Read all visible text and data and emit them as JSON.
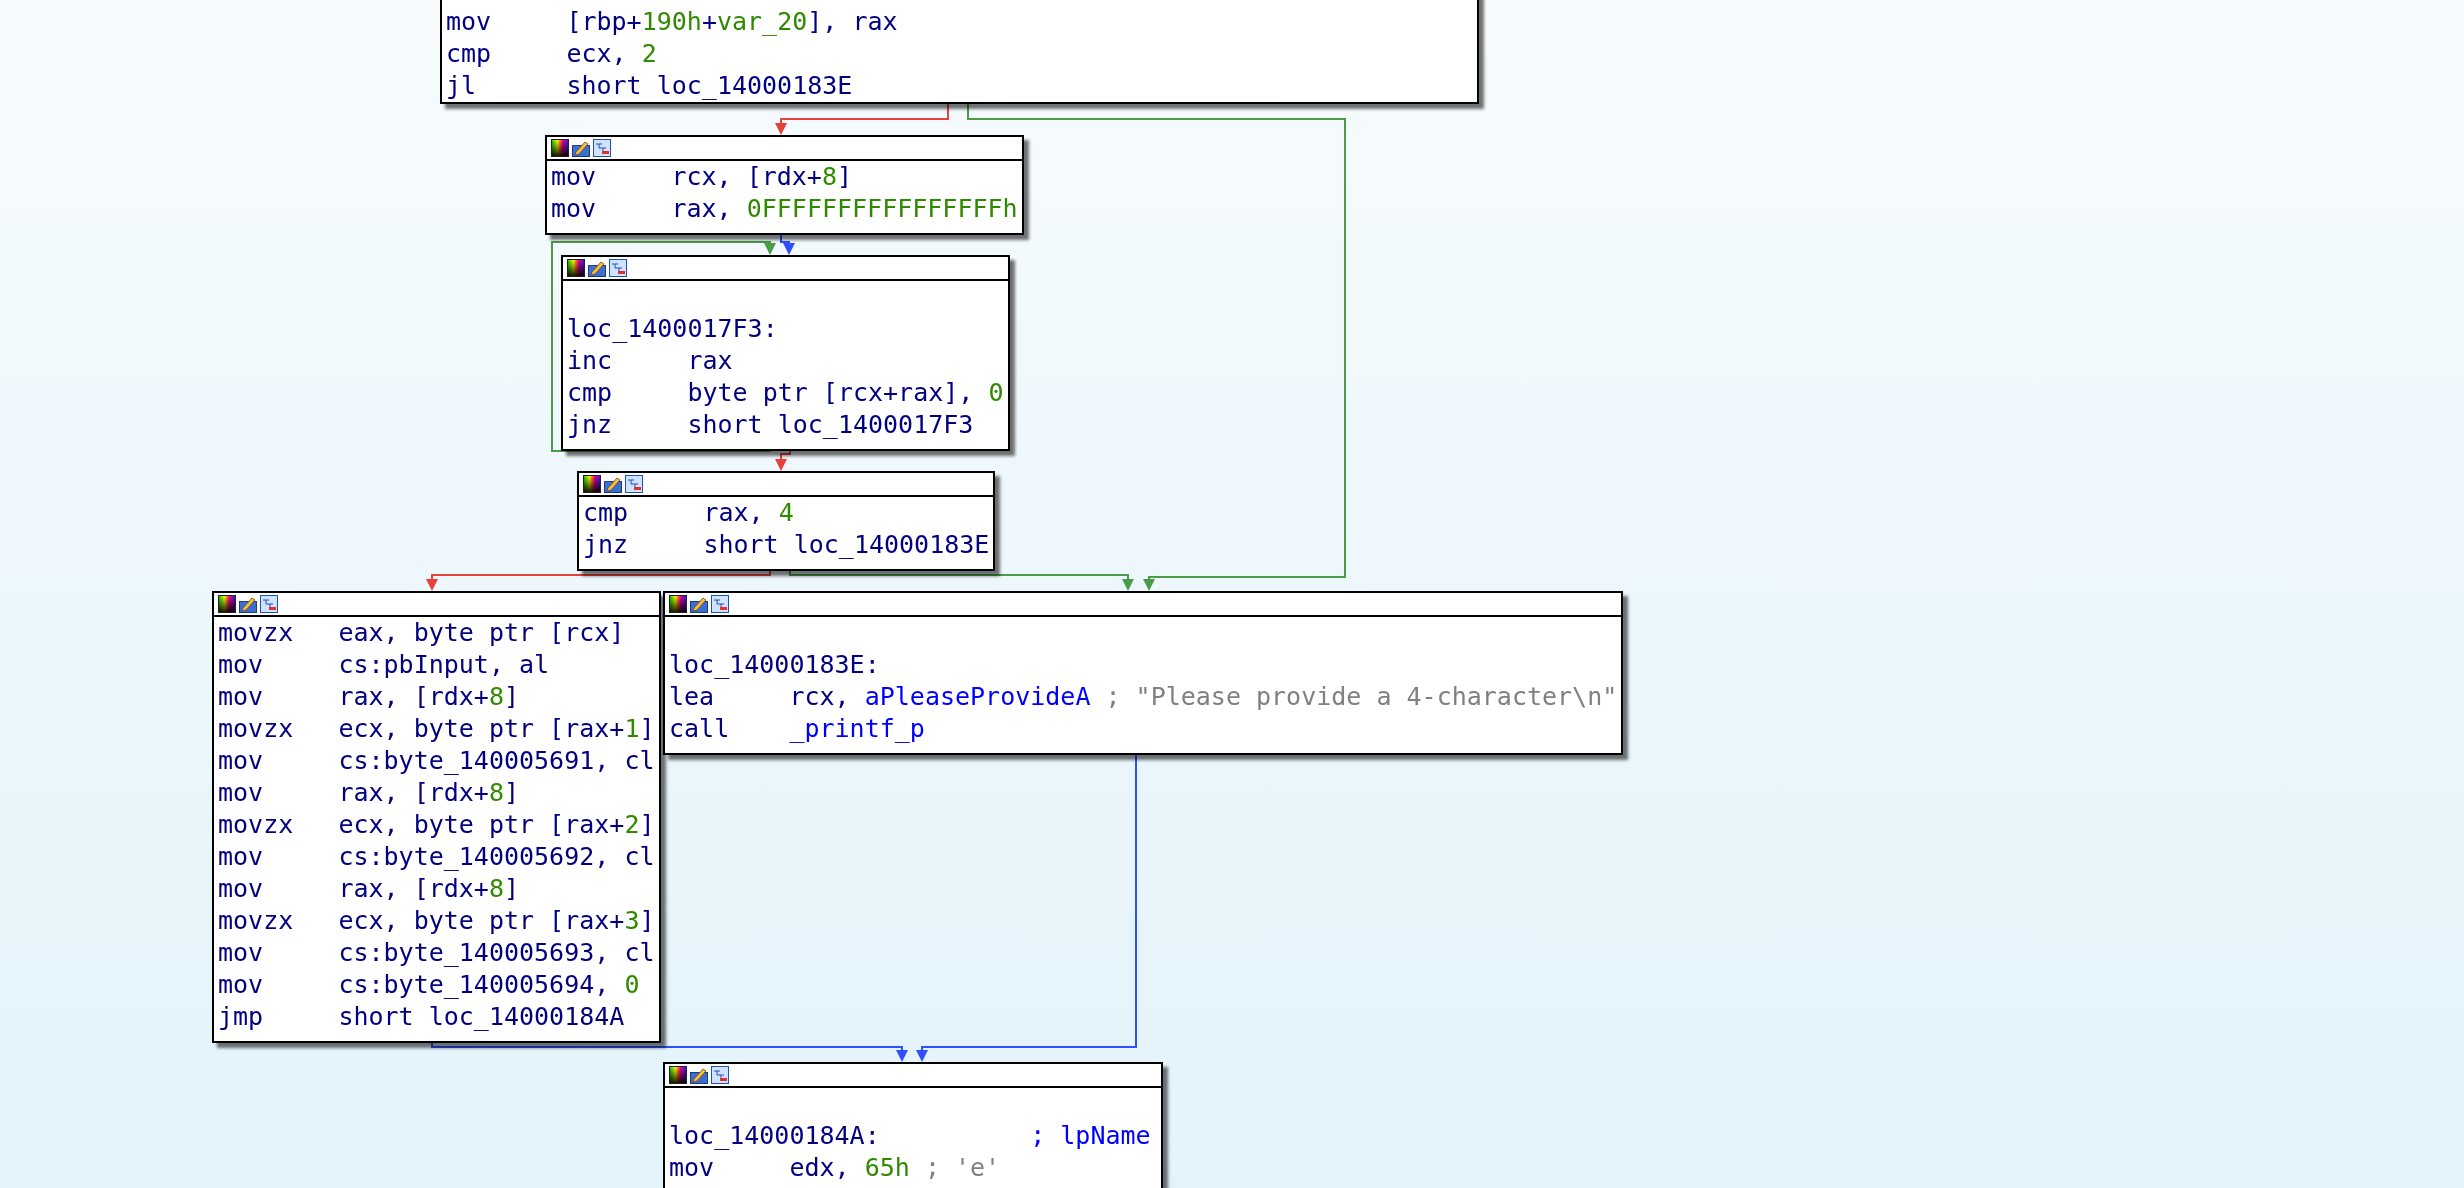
{
  "graph": {
    "nodes": [
      {
        "toolbar": false,
        "lines": [
          {
            "kind": "instruction",
            "mnemonic": "mov",
            "operands": [
              {
                "text": "[rbp+",
                "kind": "plain"
              },
              {
                "text": "190h",
                "kind": "number"
              },
              {
                "text": "+",
                "kind": "plain"
              },
              {
                "text": "var_20",
                "kind": "number"
              },
              {
                "text": "], rax",
                "kind": "plain"
              }
            ]
          },
          {
            "kind": "instruction",
            "mnemonic": "cmp",
            "operands": [
              {
                "text": "ecx, ",
                "kind": "plain"
              },
              {
                "text": "2",
                "kind": "number"
              }
            ]
          },
          {
            "kind": "instruction",
            "mnemonic": "jl",
            "operands": [
              {
                "text": "short loc_14000183E",
                "kind": "plain"
              }
            ]
          }
        ]
      },
      {
        "toolbar": true,
        "lines": [
          {
            "kind": "instruction",
            "mnemonic": "mov",
            "operands": [
              {
                "text": "rcx, [rdx+",
                "kind": "plain"
              },
              {
                "text": "8",
                "kind": "number"
              },
              {
                "text": "]",
                "kind": "plain"
              }
            ]
          },
          {
            "kind": "instruction",
            "mnemonic": "mov",
            "operands": [
              {
                "text": "rax, ",
                "kind": "plain"
              },
              {
                "text": "0FFFFFFFFFFFFFFFFh",
                "kind": "number"
              }
            ]
          }
        ]
      },
      {
        "toolbar": true,
        "lines": [
          {
            "kind": "blank"
          },
          {
            "kind": "label",
            "text": "loc_1400017F3:"
          },
          {
            "kind": "instruction",
            "mnemonic": "inc",
            "operands": [
              {
                "text": "rax",
                "kind": "plain"
              }
            ]
          },
          {
            "kind": "instruction",
            "mnemonic": "cmp",
            "operands": [
              {
                "text": "byte ptr [rcx+rax], ",
                "kind": "plain"
              },
              {
                "text": "0",
                "kind": "number"
              }
            ]
          },
          {
            "kind": "instruction",
            "mnemonic": "jnz",
            "operands": [
              {
                "text": "short loc_1400017F3",
                "kind": "plain"
              }
            ]
          }
        ]
      },
      {
        "toolbar": true,
        "lines": [
          {
            "kind": "instruction",
            "mnemonic": "cmp",
            "operands": [
              {
                "text": "rax, ",
                "kind": "plain"
              },
              {
                "text": "4",
                "kind": "number"
              }
            ]
          },
          {
            "kind": "instruction",
            "mnemonic": "jnz",
            "operands": [
              {
                "text": "short loc_14000183E",
                "kind": "plain"
              }
            ]
          }
        ]
      },
      {
        "toolbar": true,
        "lines": [
          {
            "kind": "instruction",
            "mnemonic": "movzx",
            "operands": [
              {
                "text": "eax, byte ptr [rcx]",
                "kind": "plain"
              }
            ]
          },
          {
            "kind": "instruction",
            "mnemonic": "mov",
            "operands": [
              {
                "text": "cs:pbInput, al",
                "kind": "plain"
              }
            ]
          },
          {
            "kind": "instruction",
            "mnemonic": "mov",
            "operands": [
              {
                "text": "rax, [rdx+",
                "kind": "plain"
              },
              {
                "text": "8",
                "kind": "number"
              },
              {
                "text": "]",
                "kind": "plain"
              }
            ]
          },
          {
            "kind": "instruction",
            "mnemonic": "movzx",
            "operands": [
              {
                "text": "ecx, byte ptr [rax+",
                "kind": "plain"
              },
              {
                "text": "1",
                "kind": "number"
              },
              {
                "text": "]",
                "kind": "plain"
              }
            ]
          },
          {
            "kind": "instruction",
            "mnemonic": "mov",
            "operands": [
              {
                "text": "cs:byte_140005691, cl",
                "kind": "plain"
              }
            ]
          },
          {
            "kind": "instruction",
            "mnemonic": "mov",
            "operands": [
              {
                "text": "rax, [rdx+",
                "kind": "plain"
              },
              {
                "text": "8",
                "kind": "number"
              },
              {
                "text": "]",
                "kind": "plain"
              }
            ]
          },
          {
            "kind": "instruction",
            "mnemonic": "movzx",
            "operands": [
              {
                "text": "ecx, byte ptr [rax+",
                "kind": "plain"
              },
              {
                "text": "2",
                "kind": "number"
              },
              {
                "text": "]",
                "kind": "plain"
              }
            ]
          },
          {
            "kind": "instruction",
            "mnemonic": "mov",
            "operands": [
              {
                "text": "cs:byte_140005692, cl",
                "kind": "plain"
              }
            ]
          },
          {
            "kind": "instruction",
            "mnemonic": "mov",
            "operands": [
              {
                "text": "rax, [rdx+",
                "kind": "plain"
              },
              {
                "text": "8",
                "kind": "number"
              },
              {
                "text": "]",
                "kind": "plain"
              }
            ]
          },
          {
            "kind": "instruction",
            "mnemonic": "movzx",
            "operands": [
              {
                "text": "ecx, byte ptr [rax+",
                "kind": "plain"
              },
              {
                "text": "3",
                "kind": "number"
              },
              {
                "text": "]",
                "kind": "plain"
              }
            ]
          },
          {
            "kind": "instruction",
            "mnemonic": "mov",
            "operands": [
              {
                "text": "cs:byte_140005693, cl",
                "kind": "plain"
              }
            ]
          },
          {
            "kind": "instruction",
            "mnemonic": "mov",
            "operands": [
              {
                "text": "cs:byte_140005694, ",
                "kind": "plain"
              },
              {
                "text": "0",
                "kind": "number"
              }
            ]
          },
          {
            "kind": "instruction",
            "mnemonic": "jmp",
            "operands": [
              {
                "text": "short loc_14000184A",
                "kind": "plain"
              }
            ]
          }
        ]
      },
      {
        "toolbar": true,
        "lines": [
          {
            "kind": "blank"
          },
          {
            "kind": "label",
            "text": "loc_14000183E:"
          },
          {
            "kind": "instruction",
            "mnemonic": "lea",
            "operands": [
              {
                "text": "rcx, ",
                "kind": "plain"
              },
              {
                "text": "aPleaseProvideA",
                "kind": "name"
              }
            ],
            "comment": {
              "text": "; \"Please provide a 4-character\\n\"",
              "kind": "comment"
            }
          },
          {
            "kind": "instruction",
            "mnemonic": "call",
            "operands": [
              {
                "text": "_printf_p",
                "kind": "name"
              }
            ]
          }
        ]
      },
      {
        "toolbar": true,
        "lines": [
          {
            "kind": "blank"
          },
          {
            "kind": "label",
            "text": "loc_14000184A:",
            "comment": {
              "text": "; lpName",
              "kind": "name"
            }
          },
          {
            "kind": "instruction",
            "mnemonic": "mov",
            "operands": [
              {
                "text": "edx, ",
                "kind": "plain"
              },
              {
                "text": "65h",
                "kind": "number"
              }
            ],
            "comment": {
              "text": "; 'e'",
              "kind": "comment"
            }
          }
        ]
      }
    ],
    "edges": [
      {
        "kind": "false"
      },
      {
        "kind": "true"
      },
      {
        "kind": "jump"
      },
      {
        "kind": "true"
      },
      {
        "kind": "false"
      },
      {
        "kind": "false"
      },
      {
        "kind": "true"
      },
      {
        "kind": "jump"
      },
      {
        "kind": "jump"
      }
    ]
  }
}
